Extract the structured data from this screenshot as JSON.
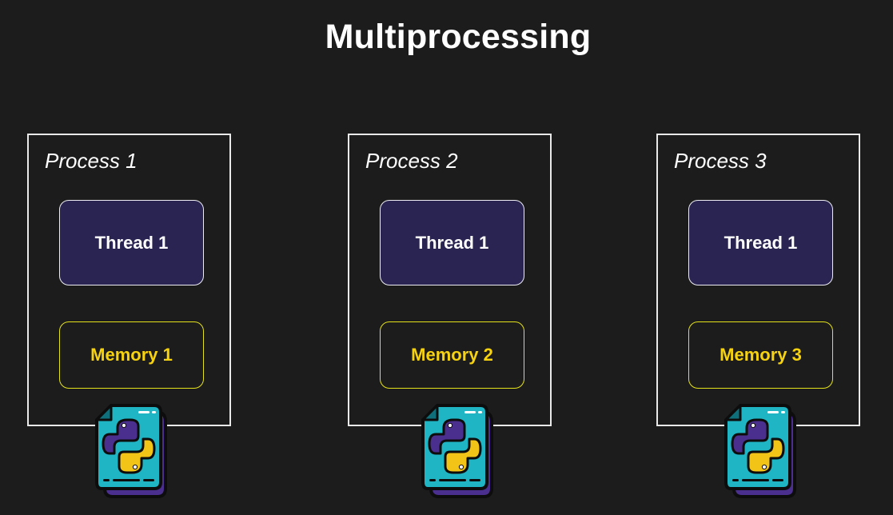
{
  "diagram": {
    "title": "Multiprocessing",
    "processes": [
      {
        "label": "Process 1",
        "thread": "Thread 1",
        "memory": "Memory 1",
        "icon": "python-file-icon"
      },
      {
        "label": "Process 2",
        "thread": "Thread 1",
        "memory": "Memory 2",
        "icon": "python-file-icon"
      },
      {
        "label": "Process 3",
        "thread": "Thread 1",
        "memory": "Memory 3",
        "icon": "python-file-icon"
      }
    ]
  },
  "colors": {
    "background": "#1c1c1c",
    "thread_fill": "#2a2452",
    "memory_text": "#f6d20f",
    "memory_border": "#e4e21a",
    "icon_teal": "#1fb5c4",
    "icon_purple": "#4b2f8f",
    "icon_yellow": "#f2c418"
  }
}
